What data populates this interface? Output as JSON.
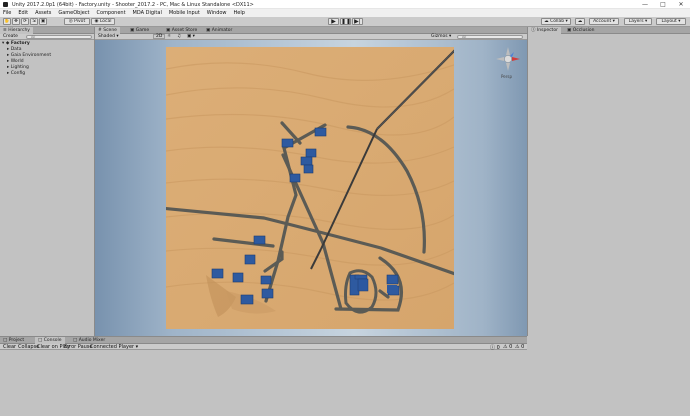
{
  "window": {
    "title": "Unity 2017.2.0p1 (64bit) - Factory.unity - Shooter_2017.2 - PC, Mac & Linux Standalone <DX11>"
  },
  "menu": [
    "File",
    "Edit",
    "Assets",
    "GameObject",
    "Component",
    "MDA Digital",
    "Mobile Input",
    "Window",
    "Help"
  ],
  "toolbar": {
    "pivot": "Pivot",
    "local": "Local",
    "collab": "Collab",
    "account": "Account",
    "layers": "Layers",
    "layout": "Layout"
  },
  "hierarchy": {
    "tab": "Hierarchy",
    "create": "Create",
    "search_placeholder": "All",
    "root": "Factory",
    "items": [
      "Data",
      "Gaia Environment",
      "World",
      "Lighting",
      "Config"
    ]
  },
  "scene": {
    "tabs": [
      "Scene",
      "Game",
      "Asset Store",
      "Animator"
    ],
    "shading": "Shaded",
    "mode_2d": "2D",
    "gizmos": "Gizmos",
    "search_placeholder": "All",
    "view_label": "Persp"
  },
  "inspector": {
    "tabs": [
      "Inspector",
      "Occlusion"
    ]
  },
  "bottom": {
    "tabs": [
      "Project",
      "Console",
      "Audio Mixer"
    ],
    "console_buttons": [
      "Clear",
      "Collapse",
      "Clear on Play",
      "Error Pause",
      "Connected Player"
    ],
    "counts": [
      "0",
      "0",
      "0"
    ]
  }
}
